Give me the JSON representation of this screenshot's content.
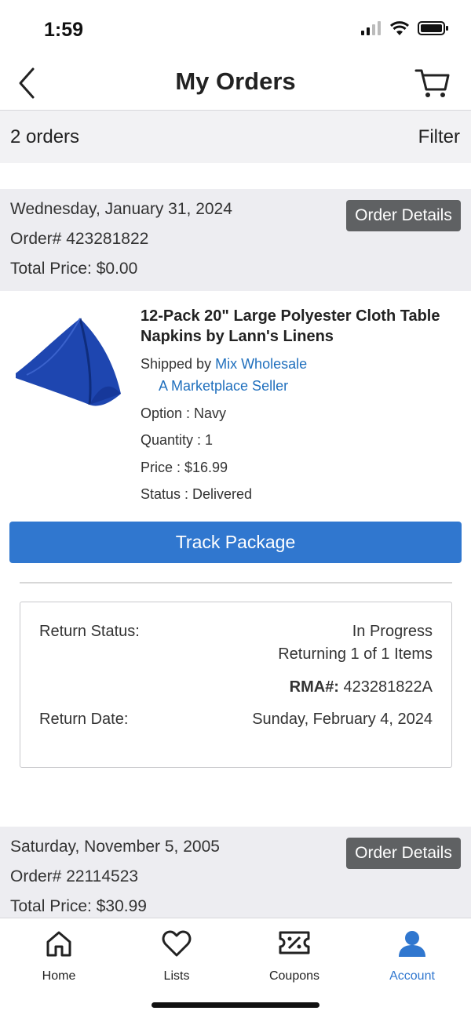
{
  "status_bar": {
    "time": "1:59"
  },
  "nav": {
    "title": "My Orders"
  },
  "summary": {
    "count": "2 orders",
    "filter_label": "Filter"
  },
  "orders": [
    {
      "date": "Wednesday, January 31, 2024",
      "order_number": "Order#  423281822",
      "total": "Total Price: $0.00",
      "details_label": "Order Details",
      "item": {
        "title": "12-Pack 20\" Large Polyester Cloth Table Napkins by Lann's Linens",
        "shipped_by_prefix": "Shipped by ",
        "shipped_by_name": "Mix Wholesale",
        "seller_type": "A Marketplace Seller",
        "option": "Option : Navy",
        "quantity": "Quantity :  1",
        "price": "Price : $16.99",
        "status": "Status : Delivered",
        "image_color": "#1e46b0"
      },
      "track_label": "Track Package",
      "return": {
        "status_label": "Return Status:",
        "status_value": "In Progress",
        "status_detail": "Returning 1 of 1 Items",
        "rma_label": "RMA#:",
        "rma_value": "423281822A",
        "date_label": "Return Date:",
        "date_value": "Sunday, February 4, 2024"
      }
    },
    {
      "date": "Saturday, November 5, 2005",
      "order_number": "Order#  22114523",
      "total": "Total Price: $30.99",
      "details_label": "Order Details"
    }
  ],
  "tabs": [
    {
      "label": "Home",
      "icon": "home-icon"
    },
    {
      "label": "Lists",
      "icon": "heart-icon"
    },
    {
      "label": "Coupons",
      "icon": "coupon-icon"
    },
    {
      "label": "Account",
      "icon": "account-icon",
      "active": true
    }
  ],
  "colors": {
    "accent": "#3077cf",
    "link": "#1f6fbd",
    "header_bg": "#ededf1",
    "details_button": "#5f6163"
  }
}
